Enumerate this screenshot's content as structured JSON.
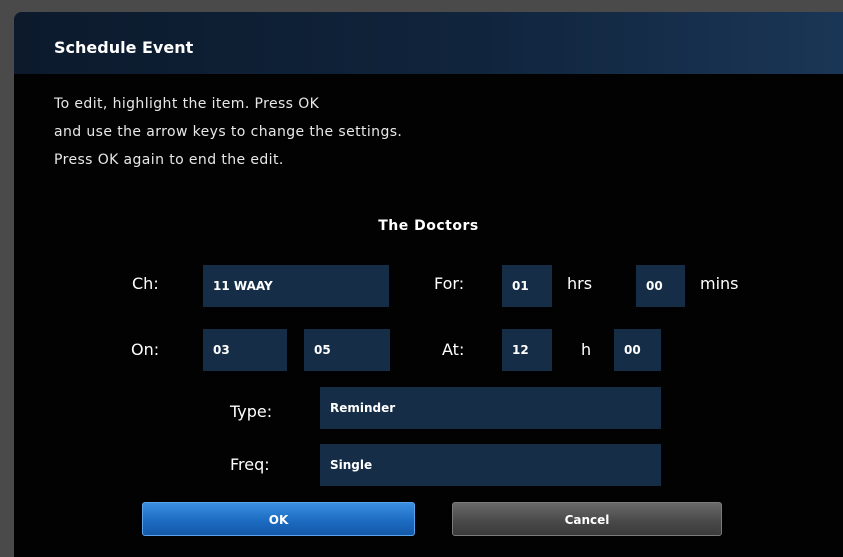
{
  "dialog": {
    "title": "Schedule Event",
    "instructions": [
      "To edit, highlight the item. Press OK",
      "and use the arrow keys to change the settings.",
      "Press OK again to end the edit."
    ],
    "program_title": "The Doctors"
  },
  "form": {
    "ch_label": "Ch:",
    "ch_value": "11 WAAY",
    "for_label": "For:",
    "for_hours": "01",
    "hrs_label": "hrs",
    "for_mins": "00",
    "mins_label": "mins",
    "on_label": "On:",
    "on_month": "03",
    "on_day": "05",
    "at_label": "At:",
    "at_hour": "12",
    "h_label": "h",
    "at_min": "00",
    "type_label": "Type:",
    "type_value": "Reminder",
    "freq_label": "Freq:",
    "freq_value": "Single"
  },
  "buttons": {
    "ok_label": "OK",
    "cancel_label": "Cancel"
  },
  "colors": {
    "field_bg": "#152d47",
    "ok_button": "#1c6cc2",
    "cancel_button": "#4a4a4a",
    "dialog_bg": "#020202"
  }
}
